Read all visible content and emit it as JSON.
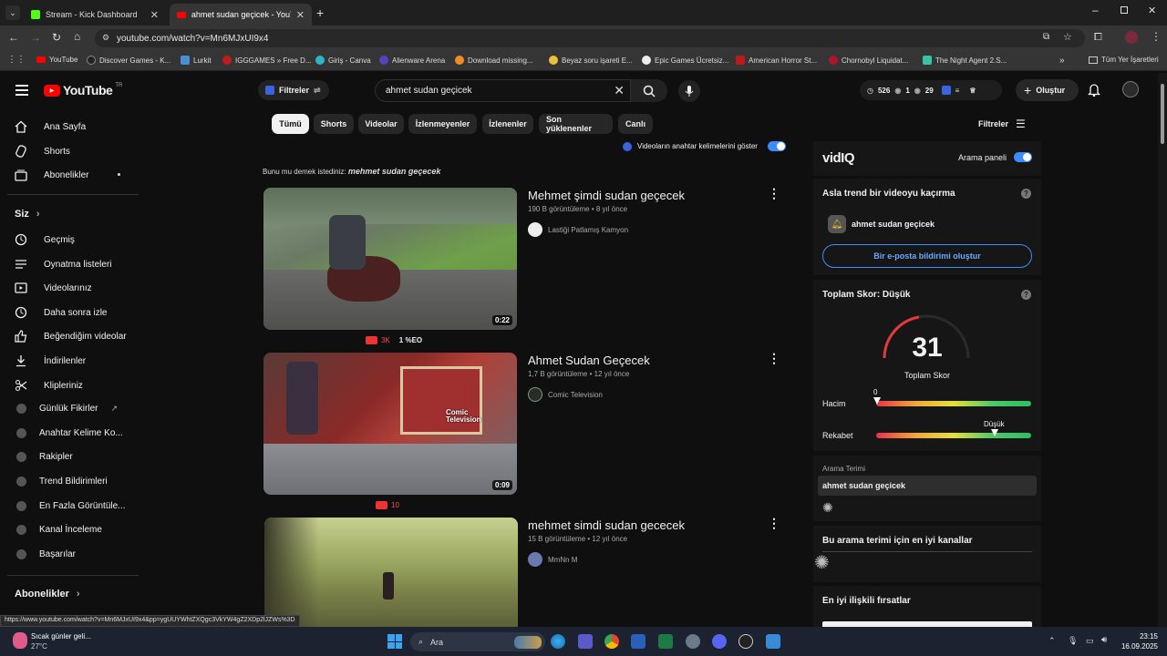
{
  "browser": {
    "tabs": [
      {
        "title": "Stream - Kick Dashboard",
        "active": false
      },
      {
        "title": "ahmet sudan geçicek - YouTube",
        "active": true
      }
    ],
    "url": "youtube.com/watch?v=Mn6MJxUI9x4",
    "bookmarks": [
      "YouTube",
      "Discover Games - K...",
      "Lurkit",
      "IGGGAMES » Free D...",
      "Giriş - Canva",
      "Alienware Arena",
      "Download missing...",
      "Beyaz soru işareti E...",
      "Epic Games Ücretsiz...",
      "American Horror St...",
      "Chornobyl Liquidat...",
      "The Night Agent 2.S..."
    ],
    "all_bookmarks": "Tüm Yer İşaretleri"
  },
  "youtube": {
    "logo": "YouTube",
    "logo_sup": "TR",
    "filters_btn": "Filtreler",
    "search_value": "ahmet sudan geçicek",
    "stats": {
      "a": "526",
      "b": "1",
      "c": "29"
    },
    "create_btn": "Oluştur",
    "filters_right": "Filtreler",
    "chips": [
      "Tümü",
      "Shorts",
      "Videolar",
      "İzlenmeyenler",
      "İzlenenler",
      "Son yüklenenler",
      "Canlı"
    ],
    "keyword_toggle": "Videoların anahtar kelimelerini göster",
    "did_you_mean_prefix": "Bunu mu demek istediniz:",
    "did_you_mean_term": "mehmet sudan geçecek",
    "status_url": "https://www.youtube.com/watch?v=Mn6MJxUI9x4&pp=ygUUYWhtZXQgc3VkYW4gZ2XDp2lJZWs%3D"
  },
  "sidebar": {
    "main": [
      {
        "label": "Ana Sayfa",
        "icon": "home-icon"
      },
      {
        "label": "Shorts",
        "icon": "shorts-icon"
      },
      {
        "label": "Abonelikler",
        "icon": "subscriptions-icon"
      }
    ],
    "you_header": "Siz",
    "you": [
      {
        "label": "Geçmiş",
        "icon": "history-icon"
      },
      {
        "label": "Oynatma listeleri",
        "icon": "playlists-icon"
      },
      {
        "label": "Videolarınız",
        "icon": "your-videos-icon"
      },
      {
        "label": "Daha sonra izle",
        "icon": "watch-later-icon"
      },
      {
        "label": "Beğendiğim videolar",
        "icon": "liked-icon"
      },
      {
        "label": "İndirilenler",
        "icon": "download-icon"
      },
      {
        "label": "Klipleriniz",
        "icon": "clips-icon"
      }
    ],
    "vidiq": [
      "Günlük Fikirler",
      "Anahtar Kelime Ko...",
      "Rakipler",
      "Trend Bildirimleri",
      "En Fazla Görüntüle...",
      "Kanal İnceleme",
      "Başarılar"
    ],
    "subs_header": "Abonelikler"
  },
  "videos": [
    {
      "title": "Mehmet şimdi sudan geçecek",
      "views": "190 B görüntüleme",
      "age": "8 yıl önce",
      "channel": "Lastiği Patlamış Kamyon",
      "duration": "0:22",
      "badge1": "3K",
      "badge2": "1 %EO"
    },
    {
      "title": "Ahmet Sudan Geçecek",
      "views": "1,7 B görüntüleme",
      "age": "12 yıl önce",
      "channel": "Comic Television",
      "duration": "0:09",
      "badge1": "10"
    },
    {
      "title": "mehmet simdi sudan gececek",
      "views": "15 B görüntüleme",
      "age": "12 yıl önce",
      "channel": "MmNn M"
    }
  ],
  "vidiq": {
    "logo": "vidIQ",
    "search_panel": "Arama paneli",
    "trend_title": "Asla trend bir videoyu kaçırma",
    "trend_term": "ahmet sudan geçicek",
    "email_btn": "Bir e-posta bildirimi oluştur",
    "score_title": "Toplam Skor: Düşük",
    "score_value": "31",
    "score_label": "Toplam Skor",
    "volume_label": "Hacim",
    "volume_value": "0",
    "competition_label": "Rekabet",
    "competition_value": "Düşük",
    "search_term_label": "Arama Terimi",
    "search_term": "ahmet sudan geçicek",
    "top_channels": "Bu arama terimi için en iyi kanallar",
    "best_opps": "En iyi ilişkili fırsatlar"
  },
  "taskbar": {
    "weather_title": "Sıcak günler geli...",
    "weather_temp": "27°C",
    "search": "Ara",
    "time": "23:15",
    "date": "16.09.2025"
  }
}
